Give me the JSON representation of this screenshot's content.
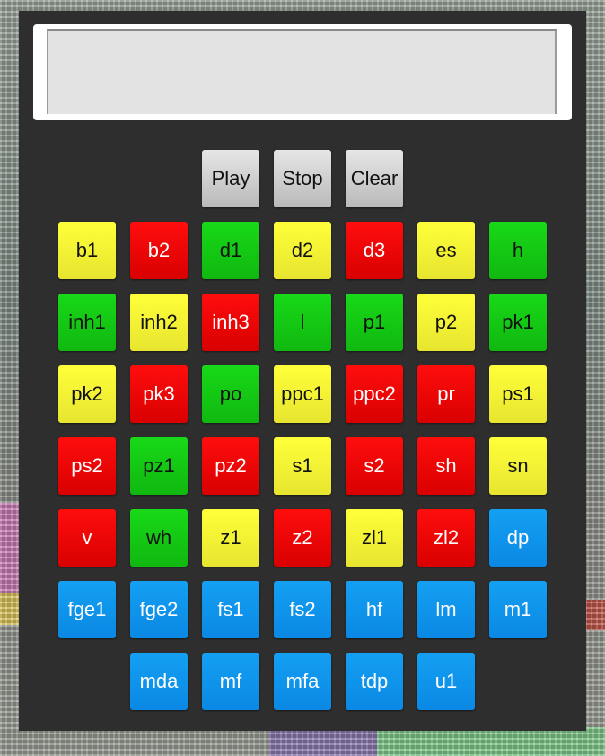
{
  "display": {
    "text": ""
  },
  "controls": {
    "play_label": "Play",
    "stop_label": "Stop",
    "clear_label": "Clear"
  },
  "colors": {
    "panel": "#2e2e2e",
    "yellow": "#ffff3a",
    "red": "#ff0d0d",
    "green": "#18d918",
    "blue": "#14a0f2",
    "control": "#d0d0d0"
  },
  "pads": [
    {
      "label": "b1",
      "color": "yellow"
    },
    {
      "label": "b2",
      "color": "red"
    },
    {
      "label": "d1",
      "color": "green"
    },
    {
      "label": "d2",
      "color": "yellow"
    },
    {
      "label": "d3",
      "color": "red"
    },
    {
      "label": "es",
      "color": "yellow"
    },
    {
      "label": "h",
      "color": "green"
    },
    {
      "label": "inh1",
      "color": "green"
    },
    {
      "label": "inh2",
      "color": "yellow"
    },
    {
      "label": "inh3",
      "color": "red"
    },
    {
      "label": "l",
      "color": "green"
    },
    {
      "label": "p1",
      "color": "green"
    },
    {
      "label": "p2",
      "color": "yellow"
    },
    {
      "label": "pk1",
      "color": "green"
    },
    {
      "label": "pk2",
      "color": "yellow"
    },
    {
      "label": "pk3",
      "color": "red"
    },
    {
      "label": "po",
      "color": "green"
    },
    {
      "label": "ppc1",
      "color": "yellow"
    },
    {
      "label": "ppc2",
      "color": "red"
    },
    {
      "label": "pr",
      "color": "red"
    },
    {
      "label": "ps1",
      "color": "yellow"
    },
    {
      "label": "ps2",
      "color": "red"
    },
    {
      "label": "pz1",
      "color": "green"
    },
    {
      "label": "pz2",
      "color": "red"
    },
    {
      "label": "s1",
      "color": "yellow"
    },
    {
      "label": "s2",
      "color": "red"
    },
    {
      "label": "sh",
      "color": "red"
    },
    {
      "label": "sn",
      "color": "yellow"
    },
    {
      "label": "v",
      "color": "red"
    },
    {
      "label": "wh",
      "color": "green"
    },
    {
      "label": "z1",
      "color": "yellow"
    },
    {
      "label": "z2",
      "color": "red"
    },
    {
      "label": "zl1",
      "color": "yellow"
    },
    {
      "label": "zl2",
      "color": "red"
    },
    {
      "label": "dp",
      "color": "blue"
    },
    {
      "label": "fge1",
      "color": "blue"
    },
    {
      "label": "fge2",
      "color": "blue"
    },
    {
      "label": "fs1",
      "color": "blue"
    },
    {
      "label": "fs2",
      "color": "blue"
    },
    {
      "label": "hf",
      "color": "blue"
    },
    {
      "label": "lm",
      "color": "blue"
    },
    {
      "label": "m1",
      "color": "blue"
    },
    {
      "label": "mda",
      "color": "blue"
    },
    {
      "label": "mf",
      "color": "blue"
    },
    {
      "label": "mfa",
      "color": "blue"
    },
    {
      "label": "tdp",
      "color": "blue"
    },
    {
      "label": "u1",
      "color": "blue"
    }
  ]
}
